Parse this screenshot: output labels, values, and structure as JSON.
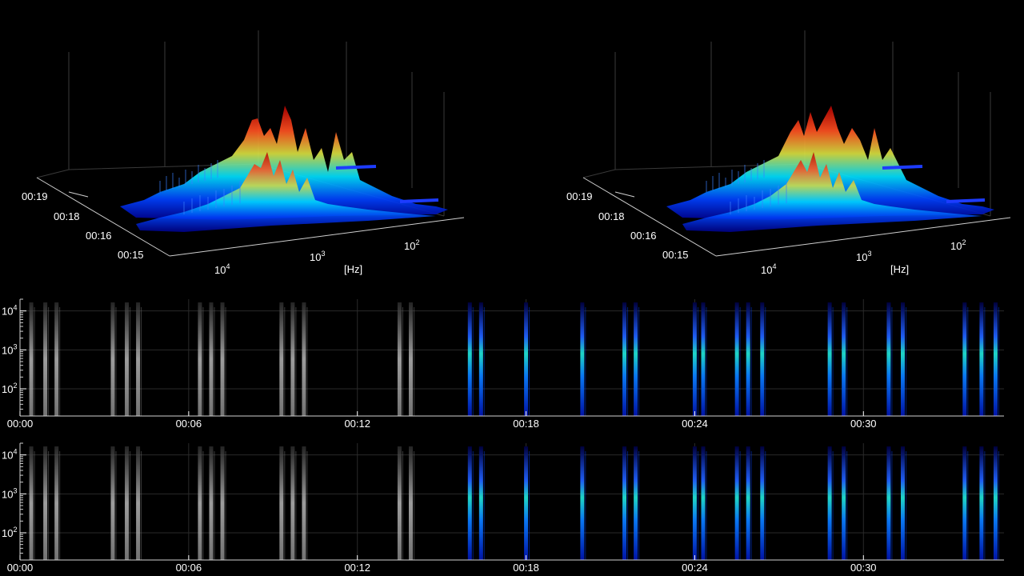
{
  "chart_data": [
    {
      "type": "surface",
      "panel": "3d-left",
      "xlabel": "[Hz]",
      "x_scale": "log",
      "x_ticks": [
        {
          "base": "10",
          "exp": "4",
          "value": 10000
        },
        {
          "base": "10",
          "exp": "3",
          "value": 1000
        },
        {
          "base": "10",
          "exp": "2",
          "value": 100
        }
      ],
      "y_ticks": [
        "00:19",
        "00:18",
        "00:16",
        "00:15"
      ],
      "grid": true
    },
    {
      "type": "surface",
      "panel": "3d-right",
      "xlabel": "[Hz]",
      "x_scale": "log",
      "x_ticks": [
        {
          "base": "10",
          "exp": "4",
          "value": 10000
        },
        {
          "base": "10",
          "exp": "3",
          "value": 1000
        },
        {
          "base": "10",
          "exp": "2",
          "value": 100
        }
      ],
      "y_ticks": [
        "00:19",
        "00:18",
        "00:16",
        "00:15"
      ],
      "grid": true
    },
    {
      "type": "heatmap",
      "panel": "spectrogram-top",
      "y_scale": "log",
      "ylim": [
        20,
        20000
      ],
      "y_ticks": [
        {
          "base": "10",
          "exp": "4",
          "value": 10000
        },
        {
          "base": "10",
          "exp": "3",
          "value": 1000
        },
        {
          "base": "10",
          "exp": "2",
          "value": 100
        }
      ],
      "x_ticks": [
        "00:00",
        "00:06",
        "00:12",
        "00:18",
        "00:24",
        "00:30"
      ],
      "xlim_seconds": [
        0,
        35
      ],
      "color_change_at_seconds": 16,
      "burst_times_seconds": [
        0.4,
        0.9,
        1.3,
        3.3,
        3.8,
        4.2,
        6.4,
        6.8,
        7.2,
        9.3,
        9.7,
        10.1,
        13.5,
        13.9,
        16.0,
        16.4,
        18.0,
        20.0,
        21.5,
        21.9,
        24.0,
        24.3,
        25.5,
        25.9,
        26.4,
        28.8,
        29.3,
        30.9,
        31.4,
        33.6,
        34.2,
        34.7
      ],
      "grid": true
    },
    {
      "type": "heatmap",
      "panel": "spectrogram-bottom",
      "y_scale": "log",
      "ylim": [
        20,
        20000
      ],
      "y_ticks": [
        {
          "base": "10",
          "exp": "4",
          "value": 10000
        },
        {
          "base": "10",
          "exp": "3",
          "value": 1000
        },
        {
          "base": "10",
          "exp": "2",
          "value": 100
        }
      ],
      "x_ticks": [
        "00:00",
        "00:06",
        "00:12",
        "00:18",
        "00:24",
        "00:30"
      ],
      "xlim_seconds": [
        0,
        35
      ],
      "color_change_at_seconds": 16,
      "burst_times_seconds": [
        0.4,
        0.9,
        1.3,
        3.3,
        3.8,
        4.2,
        6.4,
        6.8,
        7.2,
        9.3,
        9.7,
        10.1,
        13.5,
        13.9,
        16.0,
        16.4,
        18.0,
        20.0,
        21.5,
        21.9,
        24.0,
        24.3,
        25.5,
        25.9,
        26.4,
        28.8,
        29.3,
        30.9,
        31.4,
        33.6,
        34.2,
        34.7
      ],
      "grid": true
    }
  ]
}
